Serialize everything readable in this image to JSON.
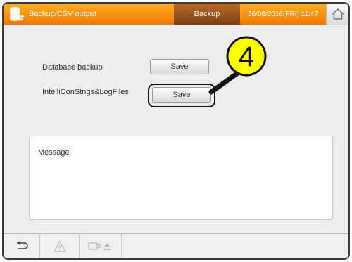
{
  "header": {
    "screen_title": "Backup/CSV output",
    "tab": "Backup",
    "datetime": "26/08/2016(FRI) 11:47"
  },
  "rows": [
    {
      "label": "Database backup",
      "button": "Save"
    },
    {
      "label": "IntelliConStngs&LogFiles",
      "button": "Save"
    }
  ],
  "callout": {
    "number": "4",
    "color": "#ffff00"
  },
  "message": {
    "label": "Message"
  },
  "colors": {
    "header_orange": "#f89a10",
    "tab_brown": "#9a5520"
  },
  "footer": {
    "icons": [
      "back-arrow-icon",
      "warning-icon",
      "usb-eject-icon"
    ]
  }
}
